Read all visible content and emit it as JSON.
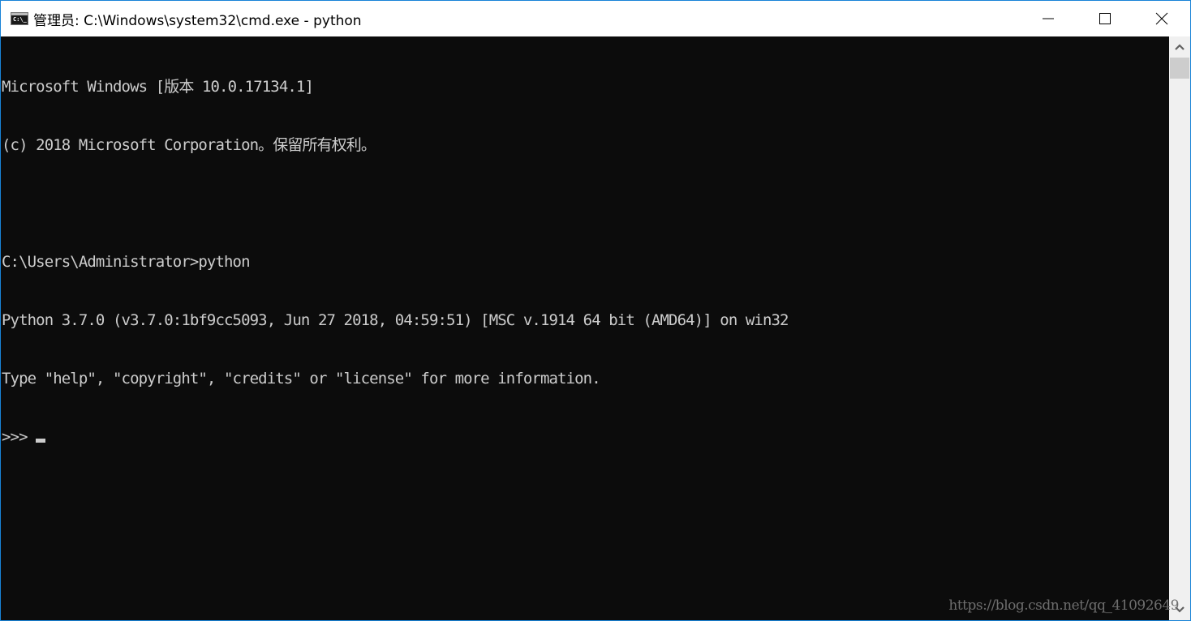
{
  "window": {
    "title": "管理员: C:\\Windows\\system32\\cmd.exe - python",
    "app_icon_label": "C:\\_",
    "controls": {
      "minimize": "minimize-icon",
      "maximize": "maximize-icon",
      "close": "close-icon"
    }
  },
  "console": {
    "lines": [
      "Microsoft Windows [版本 10.0.17134.1]",
      "(c) 2018 Microsoft Corporation。保留所有权利。",
      "",
      "C:\\Users\\Administrator>python",
      "Python 3.7.0 (v3.7.0:1bf9cc5093, Jun 27 2018, 04:59:51) [MSC v.1914 64 bit (AMD64)] on win32",
      "Type \"help\", \"copyright\", \"credits\" or \"license\" for more information."
    ],
    "prompt": ">>>"
  },
  "scrollbar": {
    "up_icon": "chevron-up-icon",
    "down_icon": "chevron-down-icon"
  },
  "watermark": "https://blog.csdn.net/qq_41092649",
  "colors": {
    "console_bg": "#0c0c0c",
    "console_fg": "#cccccc",
    "window_border": "#1883d7",
    "titlebar_bg": "#ffffff"
  }
}
